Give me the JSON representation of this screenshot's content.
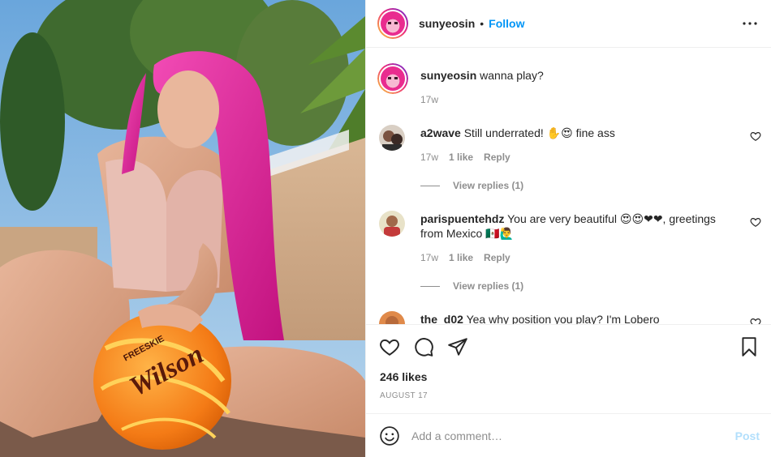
{
  "post": {
    "username": "sunyeosin",
    "follow_label": "Follow",
    "separator": "•",
    "caption_user": "sunyeosin",
    "caption_text": "wanna play?",
    "caption_time": "17w",
    "ball_text": "Wilson",
    "ball_subtext": "FREESKIE",
    "photo_description_colors": {
      "hair": "#e0249a",
      "ball": "#f7821e",
      "sky": "#7fb6e2"
    }
  },
  "comments": [
    {
      "user": "a2wave",
      "text": "Still underrated! ✋😍 fine ass",
      "time": "17w",
      "likes": "1 like",
      "reply_label": "Reply",
      "view_replies": "View replies (1)"
    },
    {
      "user": "parispuentehdz",
      "text": "You are very beautiful 😍😍❤❤, greetings from Mexico 🇲🇽🙋‍♂️",
      "time": "17w",
      "likes": "1 like",
      "reply_label": "Reply",
      "view_replies": "View replies (1)"
    },
    {
      "user": "the_d02",
      "text": "Yea why position you play? I'm Lobero"
    }
  ],
  "actions": {
    "likes_count": "246 likes",
    "date": "AUGUST 17"
  },
  "add_comment": {
    "placeholder": "Add a comment…",
    "post_label": "Post"
  },
  "icons": {
    "more": "more-horizontal-icon",
    "heart": "heart-icon",
    "comment": "comment-icon",
    "share": "share-icon",
    "save": "bookmark-icon",
    "emoji": "emoji-icon"
  }
}
